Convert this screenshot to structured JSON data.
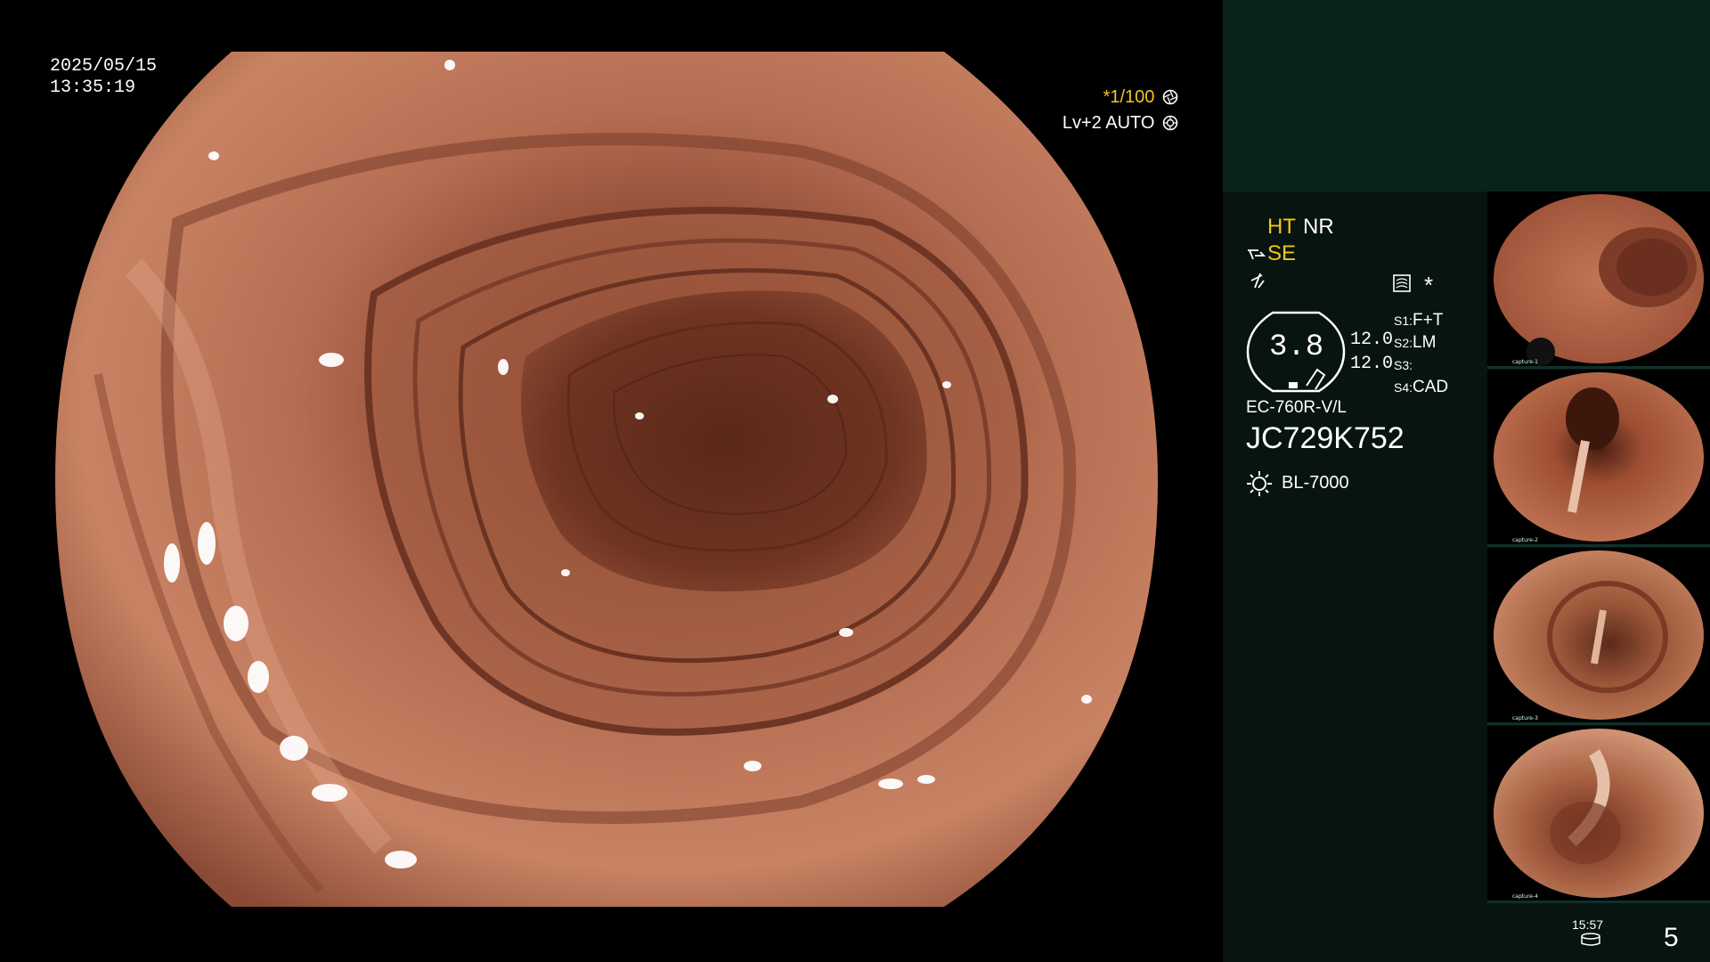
{
  "overlay": {
    "date": "2025/05/15",
    "time": "13:35:19",
    "shutter": "*1/100",
    "level": "Lv+2",
    "iris_mode": "AUTO"
  },
  "settings": {
    "ht": "HT",
    "nr": "NR",
    "se": "SE",
    "star": "*",
    "zoom_value": "3.8",
    "value_1": "12.0",
    "value_2": "12.0",
    "switches": [
      {
        "key": "S1:",
        "value": "F+T"
      },
      {
        "key": "S2:",
        "value": "LM"
      },
      {
        "key": "S3:",
        "value": ""
      },
      {
        "key": "S4:",
        "value": "CAD"
      }
    ],
    "scope_model": "EC-760R-V/L",
    "serial": "JC729K752",
    "light_source": "BL-7000"
  },
  "thumbnails": [
    {
      "label": "capture-1"
    },
    {
      "label": "capture-2"
    },
    {
      "label": "capture-3"
    },
    {
      "label": "capture-4"
    }
  ],
  "footer": {
    "small_counter": "15:57",
    "image_count": "5"
  },
  "icons": [
    "aperture-icon",
    "iris-icon",
    "structure-enhance-icon",
    "color-mode-icon",
    "image-mode-icon",
    "lamp-icon",
    "storage-icon"
  ],
  "colors": {
    "overlay_yellow": "#f2c61c",
    "panel_bg": "#07140f",
    "panel_top": "#0a221c",
    "tissue": "#b46a4f"
  }
}
